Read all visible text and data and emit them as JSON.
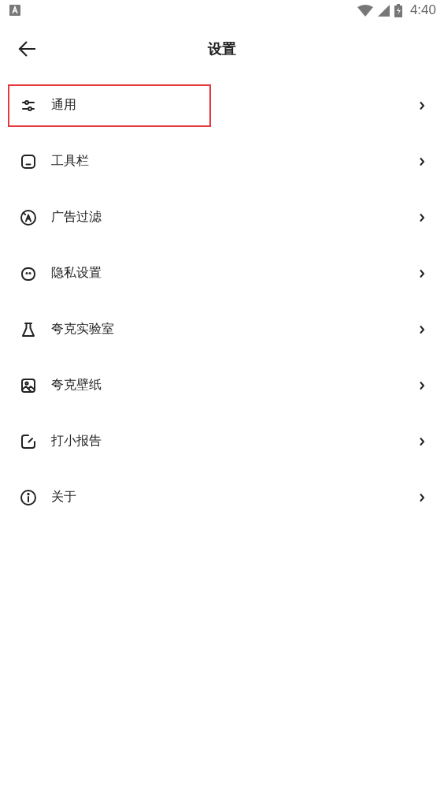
{
  "status_bar": {
    "time": "4:40"
  },
  "header": {
    "title": "设置"
  },
  "items": [
    {
      "label": "通用",
      "highlighted": true
    },
    {
      "label": "工具栏",
      "highlighted": false
    },
    {
      "label": "广告过滤",
      "highlighted": false
    },
    {
      "label": "隐私设置",
      "highlighted": false
    },
    {
      "label": "夸克实验室",
      "highlighted": false
    },
    {
      "label": "夸克壁纸",
      "highlighted": false
    },
    {
      "label": "打小报告",
      "highlighted": false
    },
    {
      "label": "关于",
      "highlighted": false
    }
  ]
}
